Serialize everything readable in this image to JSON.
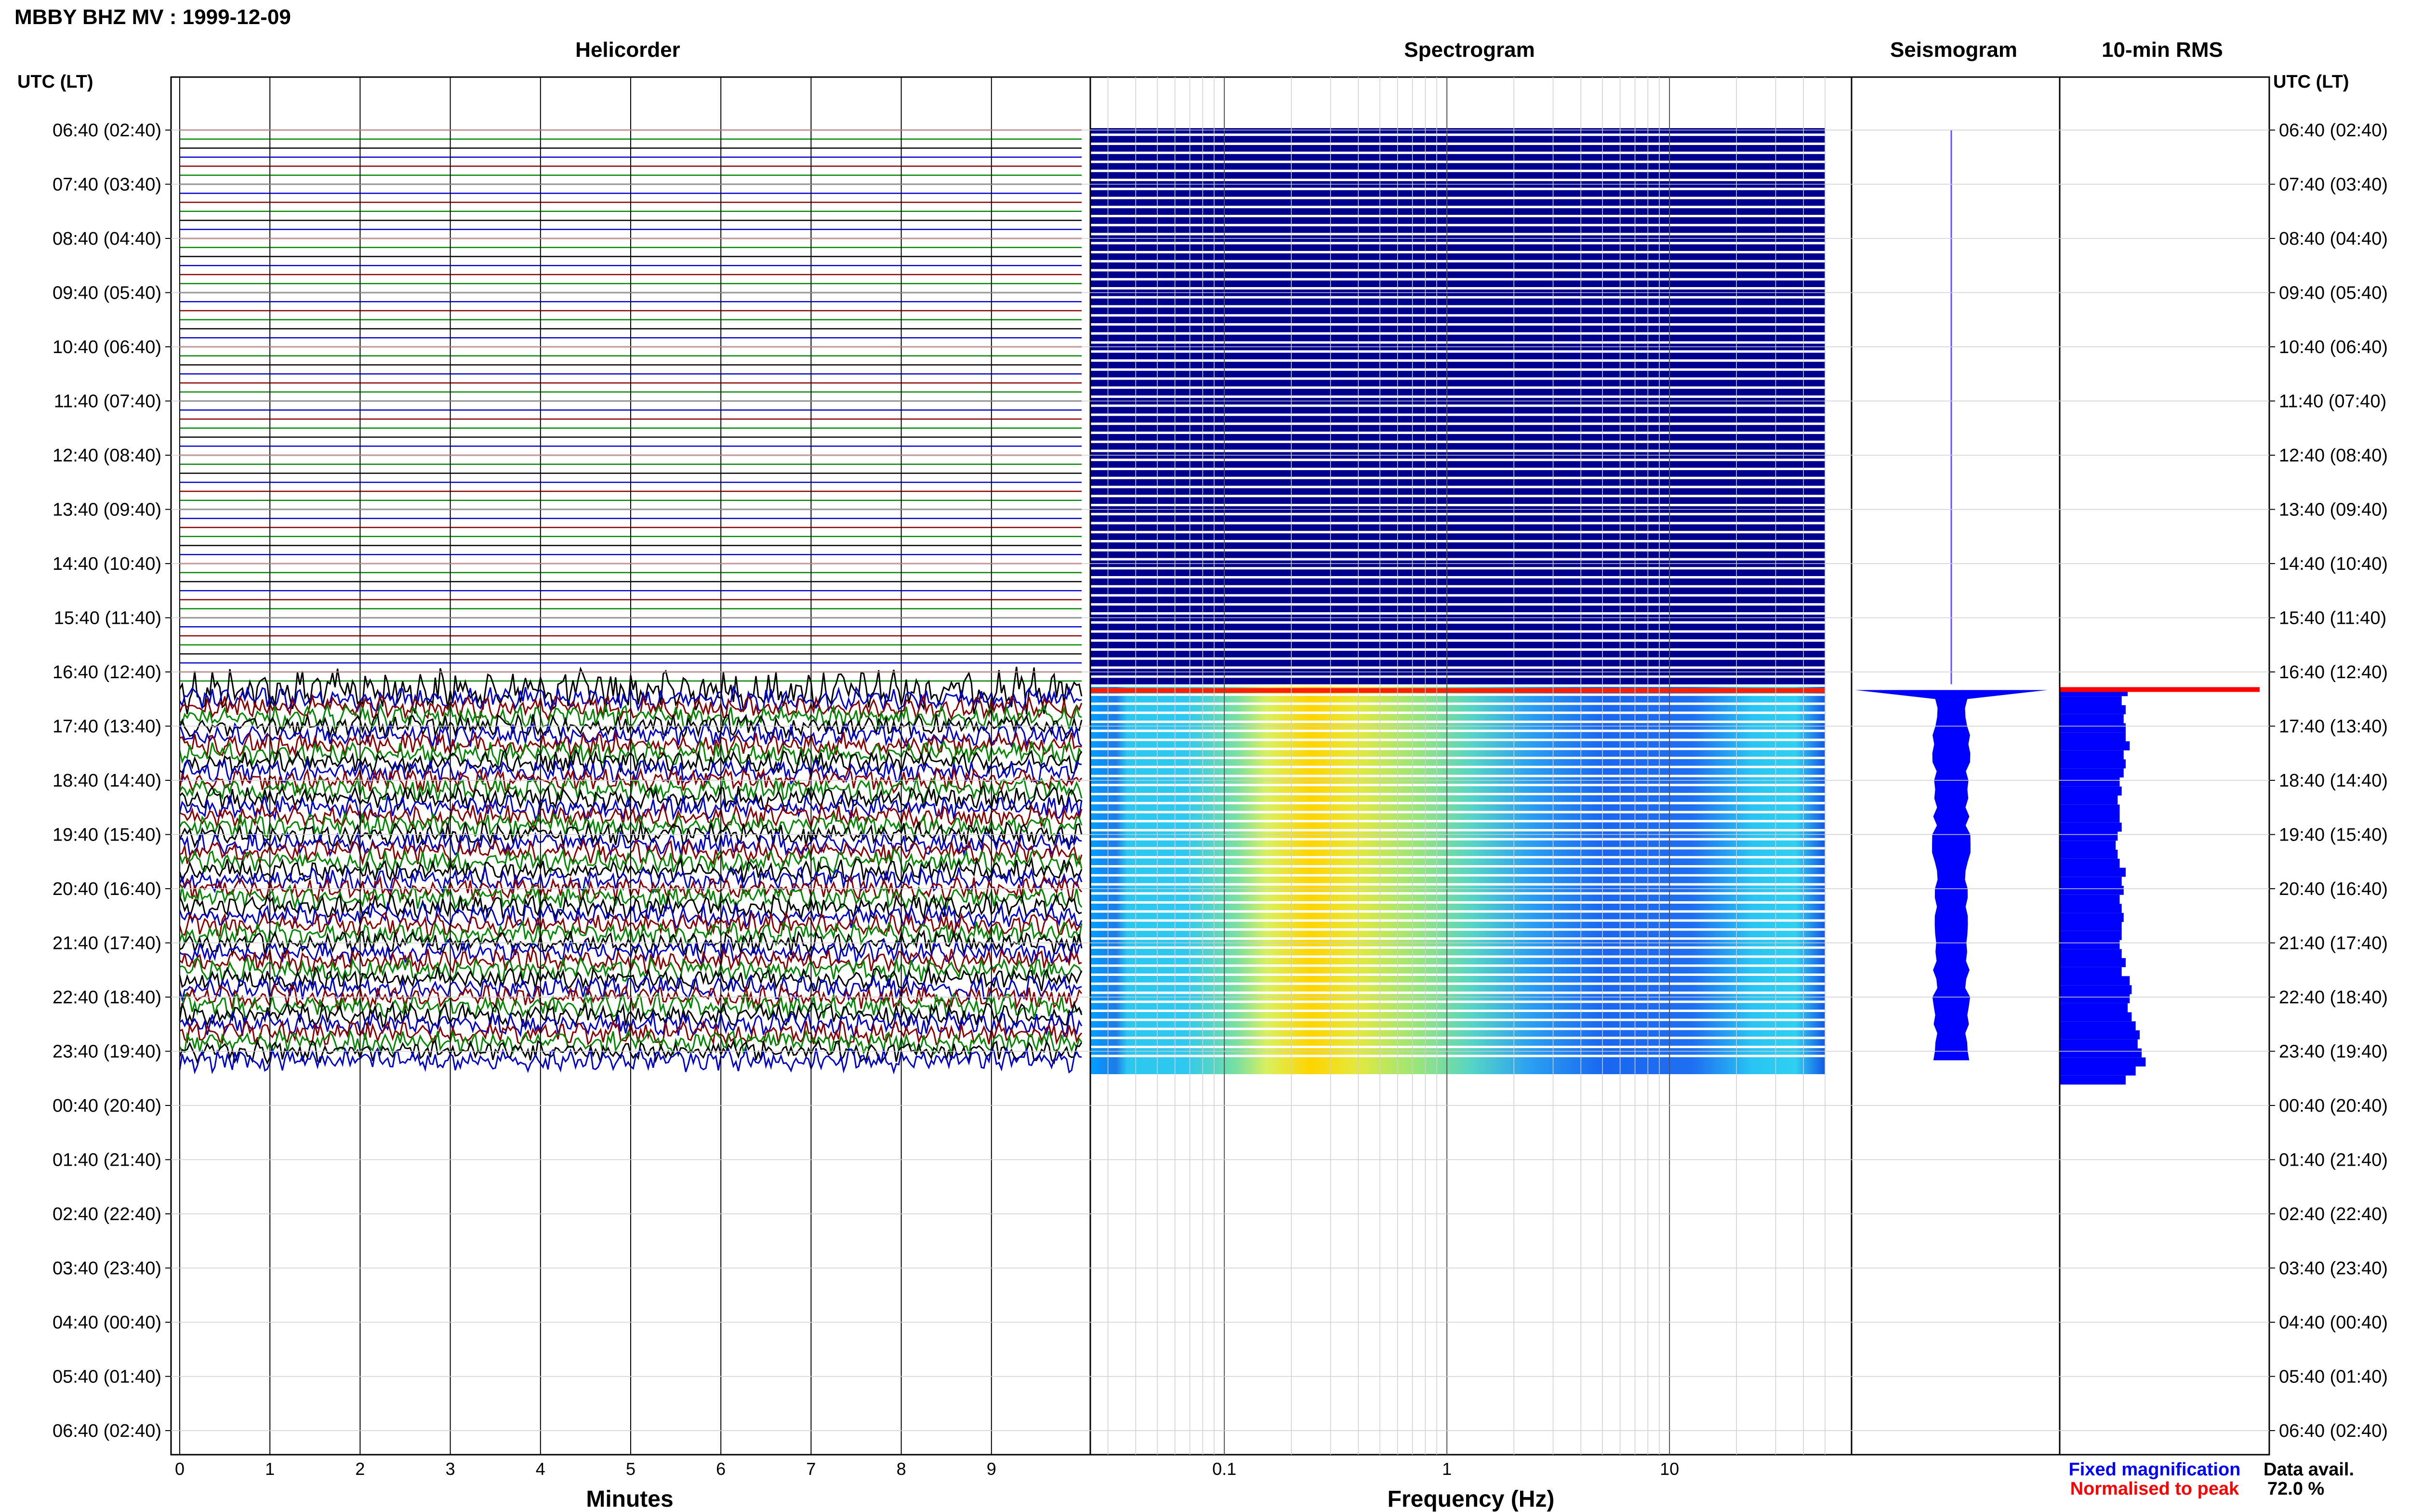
{
  "header": {
    "title": "MBBY BHZ MV : 1999-12-09",
    "time_label_left": "UTC (LT)",
    "time_label_right": "UTC (LT)"
  },
  "panels": {
    "helicorder": "Helicorder",
    "spectrogram": "Spectrogram",
    "seismogram": "Seismogram",
    "rms": "10-min RMS"
  },
  "axes": {
    "minutes_label": "Minutes",
    "frequency_label": "Frequency (Hz)"
  },
  "legend": {
    "fixed": "Fixed magnification",
    "normalised": "Normalised to peak",
    "fixed_color": "#0000ff",
    "normalised_color": "#ff0000"
  },
  "availability": {
    "label": "Data avail.",
    "value": "72.0 %"
  },
  "colors": {
    "trace_palette": [
      "#000000",
      "#0000cc",
      "#8b0000",
      "#008800"
    ],
    "spectrogram_empty": "#00008f",
    "seismogram": "#0000ff",
    "rms_bar": "#0000ff",
    "rms_peak": "#ff0000"
  },
  "chart_data": {
    "type": "helicorder",
    "time_ticks": [
      "06:40 (02:40)",
      "07:40 (03:40)",
      "08:40 (04:40)",
      "09:40 (05:40)",
      "10:40 (06:40)",
      "11:40 (07:40)",
      "12:40 (08:40)",
      "13:40 (09:40)",
      "14:40 (10:40)",
      "15:40 (11:40)",
      "16:40 (12:40)",
      "17:40 (13:40)",
      "18:40 (14:40)",
      "19:40 (15:40)",
      "20:40 (16:40)",
      "21:40 (17:40)",
      "22:40 (18:40)",
      "23:40 (19:40)",
      "00:40 (20:40)",
      "01:40 (21:40)",
      "02:40 (22:40)",
      "03:40 (23:40)",
      "04:40 (00:40)",
      "05:40 (01:40)",
      "06:40 (02:40)"
    ],
    "helicorder": {
      "x_ticks": [
        "0",
        "1",
        "2",
        "3",
        "4",
        "5",
        "6",
        "7",
        "8",
        "9"
      ],
      "xlim": [
        0,
        10
      ],
      "row_minutes": 10
    },
    "spectrogram": {
      "x_scale": "log",
      "x_ticks": [
        "0.1",
        "1",
        "10"
      ],
      "xlim": [
        0.025,
        50
      ]
    },
    "data_start_hour": 17,
    "data_end_hour": 24,
    "rms_profile": [
      0.34,
      0.31,
      0.33,
      0.32,
      0.33,
      0.33,
      0.35,
      0.32,
      0.33,
      0.32,
      0.3,
      0.31,
      0.29,
      0.3,
      0.3,
      0.31,
      0.29,
      0.28,
      0.29,
      0.3,
      0.33,
      0.31,
      0.32,
      0.3,
      0.31,
      0.32,
      0.31,
      0.31,
      0.3,
      0.31,
      0.33,
      0.31,
      0.35,
      0.36,
      0.35,
      0.34,
      0.36,
      0.38,
      0.4,
      0.39,
      0.41,
      0.43,
      0.38,
      0.33
    ]
  }
}
